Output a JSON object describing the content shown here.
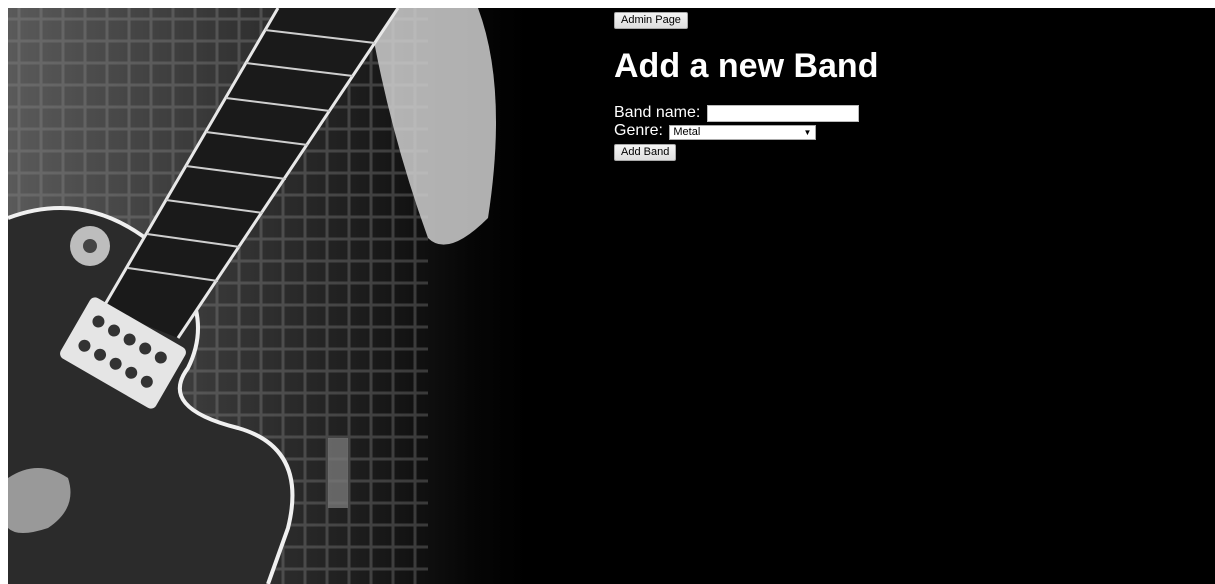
{
  "admin_button": {
    "label": "Admin Page"
  },
  "heading": "Add a new Band",
  "form": {
    "band_name_label": "Band name:",
    "band_name_value": "",
    "genre_label": "Genre:",
    "genre_selected": "Metal",
    "submit_label": "Add Band"
  },
  "icons": {
    "dropdown": "chevron-down-icon"
  },
  "colors": {
    "background": "#000000",
    "text": "#ffffff"
  }
}
